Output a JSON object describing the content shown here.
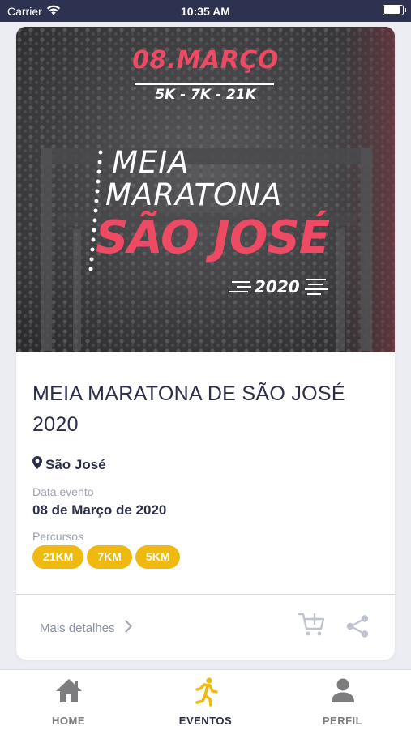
{
  "status_bar": {
    "carrier": "Carrier",
    "time": "10:35 AM",
    "icons": [
      "wifi-icon",
      "battery-icon"
    ]
  },
  "event": {
    "banner": {
      "date": "08.MARÇO",
      "distances": "5K - 7K - 21K",
      "title_line1": "MEIA",
      "title_line2": "MARATONA",
      "title_line3": "SÃO JOSÉ",
      "year": "2020",
      "accent_color": "#ef4a63"
    },
    "title": "MEIA MARATONA DE SÃO JOSÉ 2020",
    "location": "São José",
    "date_label": "Data evento",
    "date_value": "08 de Março de 2020",
    "routes_label": "Percursos",
    "routes": [
      "21KM",
      "7KM",
      "5KM"
    ],
    "chip_color": "#f0b90f"
  },
  "actions": {
    "details_label": "Mais detalhes",
    "icons": [
      "add-to-cart-icon",
      "share-icon",
      "chevron-right-icon"
    ]
  },
  "tabbar": {
    "tabs": [
      {
        "label": "HOME",
        "icon": "home-icon",
        "active": false
      },
      {
        "label": "EVENTOS",
        "icon": "runner-icon",
        "active": true
      },
      {
        "label": "PERFIL",
        "icon": "user-icon",
        "active": false
      }
    ],
    "active_color": "#f0b90f"
  }
}
